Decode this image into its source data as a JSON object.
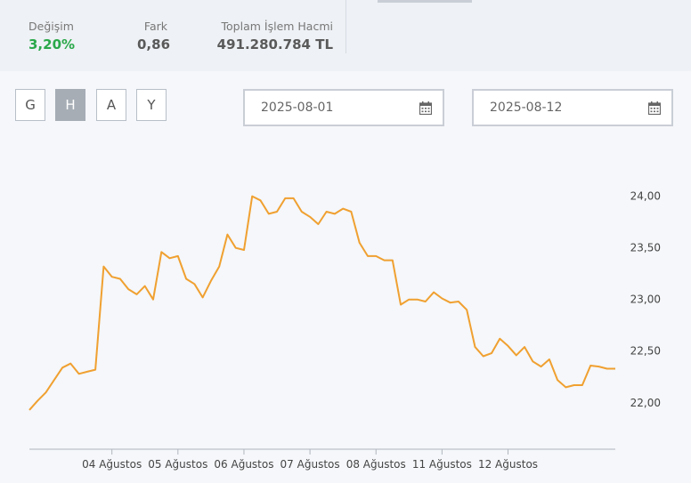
{
  "stats": {
    "change": {
      "label": "Değişim",
      "value": "3,20%"
    },
    "diff": {
      "label": "Fark",
      "value": "0,86"
    },
    "volume": {
      "label": "Toplam İşlem Hacmi",
      "value": "491.280.784 TL"
    }
  },
  "period_buttons": [
    {
      "label": "G",
      "active": false
    },
    {
      "label": "H",
      "active": true
    },
    {
      "label": "A",
      "active": false
    },
    {
      "label": "Y",
      "active": false
    }
  ],
  "date_range": {
    "start": "2025-08-01",
    "end": "2025-08-12"
  },
  "icons": {
    "calendar": "calendar-icon"
  },
  "colors": {
    "line": "#f0a030",
    "positive": "#2aa84a",
    "active_button": "#a6adb5"
  },
  "chart_data": {
    "type": "line",
    "title": "",
    "xlabel": "",
    "ylabel": "",
    "ylim": [
      21.55,
      24.35
    ],
    "y_ticks": [
      "22,00",
      "22,50",
      "23,00",
      "23,50",
      "24,00"
    ],
    "y_tick_values": [
      22.0,
      22.5,
      23.0,
      23.5,
      24.0
    ],
    "x_tick_labels": [
      "04 Ağustos",
      "05 Ağustos",
      "06 Ağustos",
      "07 Ağustos",
      "08 Ağustos",
      "11 Ağustos",
      "12 Ağustos"
    ],
    "x_tick_index": [
      10,
      18,
      26,
      34,
      42,
      50,
      58
    ],
    "grid": false,
    "legend": "none",
    "series": [
      {
        "values": [
          21.93,
          22.02,
          22.1,
          22.22,
          22.34,
          22.38,
          22.28,
          22.3,
          22.32,
          23.32,
          23.22,
          23.2,
          23.1,
          23.05,
          23.13,
          23.0,
          23.46,
          23.4,
          23.42,
          23.2,
          23.15,
          23.02,
          23.18,
          23.32,
          23.63,
          23.5,
          23.48,
          24.0,
          23.96,
          23.83,
          23.85,
          23.98,
          23.98,
          23.85,
          23.8,
          23.73,
          23.85,
          23.83,
          23.88,
          23.85,
          23.55,
          23.42,
          23.42,
          23.38,
          23.38,
          22.95,
          23.0,
          23.0,
          22.98,
          23.07,
          23.01,
          22.97,
          22.98,
          22.9,
          22.54,
          22.45,
          22.48,
          22.62,
          22.55,
          22.46,
          22.54,
          22.4,
          22.35,
          22.42,
          22.22,
          22.15,
          22.17,
          22.17,
          22.36,
          22.35,
          22.33,
          22.33
        ]
      }
    ]
  }
}
